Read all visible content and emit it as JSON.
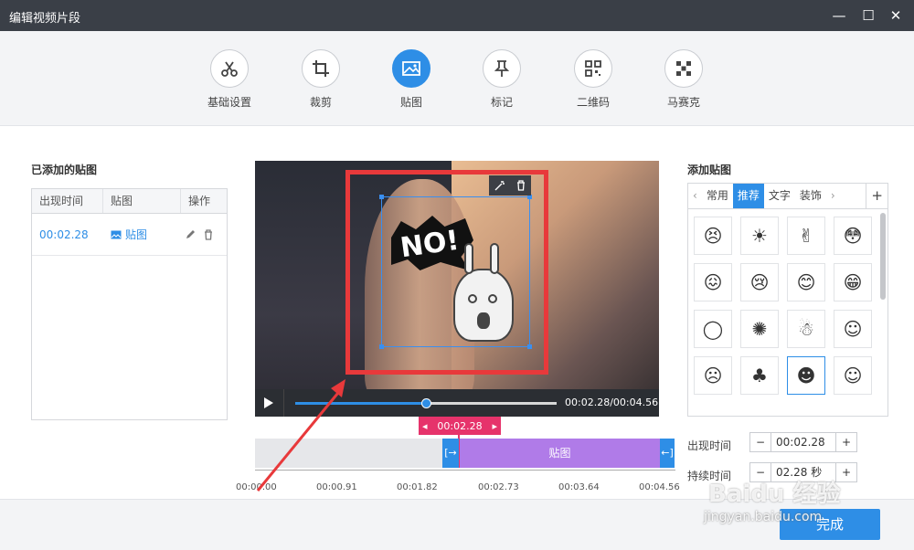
{
  "window": {
    "title": "编辑视频片段"
  },
  "toolbar": {
    "tools": [
      {
        "label": "基础设置",
        "icon": "scissors-icon"
      },
      {
        "label": "裁剪",
        "icon": "crop-icon"
      },
      {
        "label": "贴图",
        "icon": "image-icon",
        "active": true
      },
      {
        "label": "标记",
        "icon": "pin-icon"
      },
      {
        "label": "二维码",
        "icon": "qrcode-icon"
      },
      {
        "label": "马赛克",
        "icon": "mosaic-icon"
      }
    ]
  },
  "added_list": {
    "title": "已添加的贴图",
    "columns": [
      "出现时间",
      "贴图",
      "操作"
    ],
    "rows": [
      {
        "time": "00:02.28",
        "name": "贴图"
      }
    ]
  },
  "preview": {
    "sticker_text": "NO!",
    "time_display": "00:02.28/00:04.56",
    "progress": 0.5
  },
  "timeline": {
    "marker_time": "00:02.28",
    "clip_label": "贴图",
    "ticks": [
      "00:00.00",
      "00:00.91",
      "00:01.82",
      "00:02.73",
      "00:03.64",
      "00:04.56"
    ]
  },
  "sticker_panel": {
    "title": "添加贴图",
    "tabs": [
      "常用",
      "推荐",
      "文字",
      "装饰"
    ],
    "active_tab": "推荐",
    "add_label": "+"
  },
  "fields": {
    "appear_label": "出现时间",
    "appear_value": "00:02.28",
    "duration_label": "持续时间",
    "duration_value": "02.28",
    "duration_unit": "秒"
  },
  "done_button": "完成",
  "watermark": {
    "text1": "Baidu 经验",
    "text2": "jingyan.baidu.com"
  },
  "colors": {
    "accent": "#2e8ee6",
    "annotation": "#e8393b",
    "clip": "#b07be8",
    "marker": "#e6336b"
  }
}
